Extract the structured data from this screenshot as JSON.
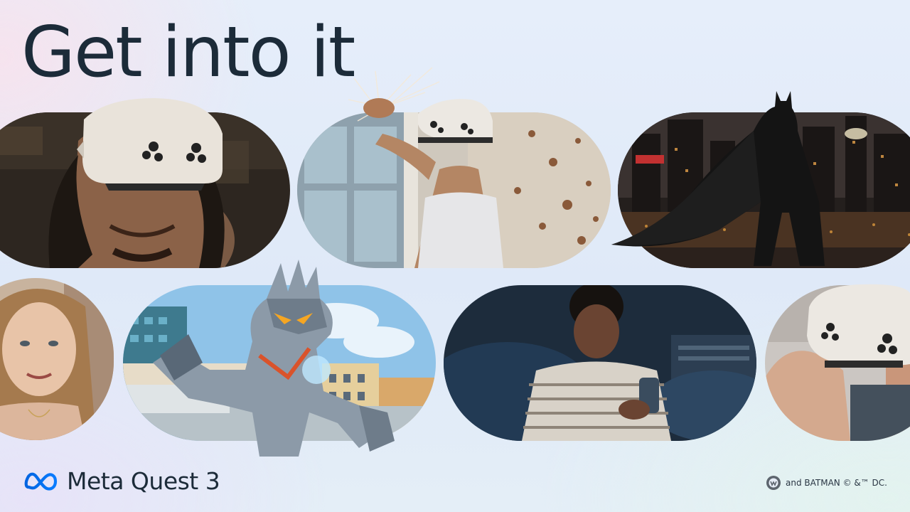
{
  "headline": "Get into it",
  "brand": {
    "logo_icon": "meta-infinity-logo",
    "name": "Meta Quest 3"
  },
  "credit": {
    "icon": "wb-games-badge-icon",
    "text": "and BATMAN © &™ DC."
  },
  "tiles": [
    "man-wearing-headset-photo",
    "woman-punching-mixed-reality-photo",
    "batman-rooftop-city-scene",
    "smiling-woman-portrait-photo",
    "robot-monster-city-game-scene",
    "teen-holding-controller-in-bed-photo",
    "hands-holding-headset-photo"
  ],
  "colors": {
    "headline": "#1c2b39",
    "brand_blue": "#0a66e4",
    "background": "#e2ebf8"
  }
}
